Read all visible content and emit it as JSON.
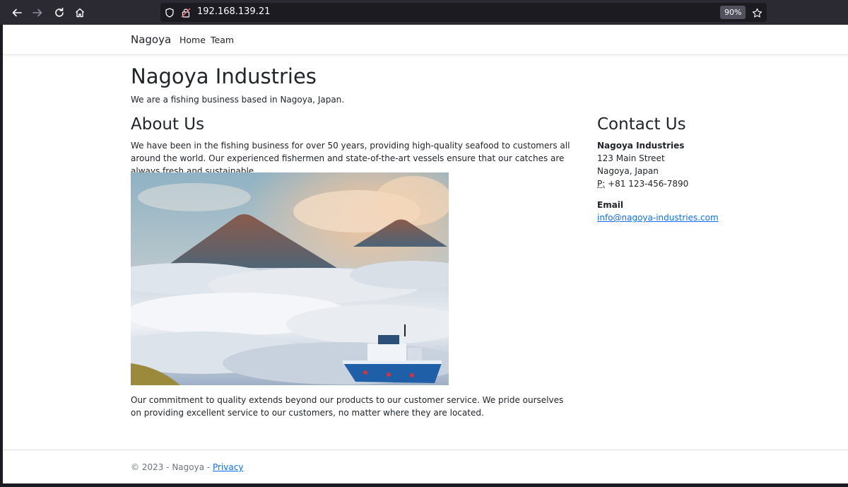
{
  "browser": {
    "url": "192.168.139.21",
    "zoom": "90%"
  },
  "site": {
    "brand": "Nagoya",
    "nav": [
      "Home",
      "Team"
    ]
  },
  "main": {
    "title": "Nagoya Industries",
    "lead": "We are a fishing business based in Nagoya, Japan.",
    "about_heading": "About Us",
    "about_p1": "We have been in the fishing business for over 50 years, providing high-quality seafood to customers all around the world. Our experienced fishermen and state-of-the-art vessels ensure that our catches are always fresh and sustainable.",
    "about_p2": "Our commitment to quality extends beyond our products to our customer service. We pride ourselves on providing excellent service to our customers, no matter where they are located."
  },
  "contact": {
    "heading": "Contact Us",
    "company": "Nagoya Industries",
    "street": "123 Main Street",
    "city": "Nagoya, Japan",
    "phone_label": "P:",
    "phone": "+81 123-456-7890",
    "email_label": "Email",
    "email": "info@nagoya-industries.com"
  },
  "footer": {
    "copyright": "© 2023 - Nagoya - ",
    "privacy": "Privacy"
  }
}
